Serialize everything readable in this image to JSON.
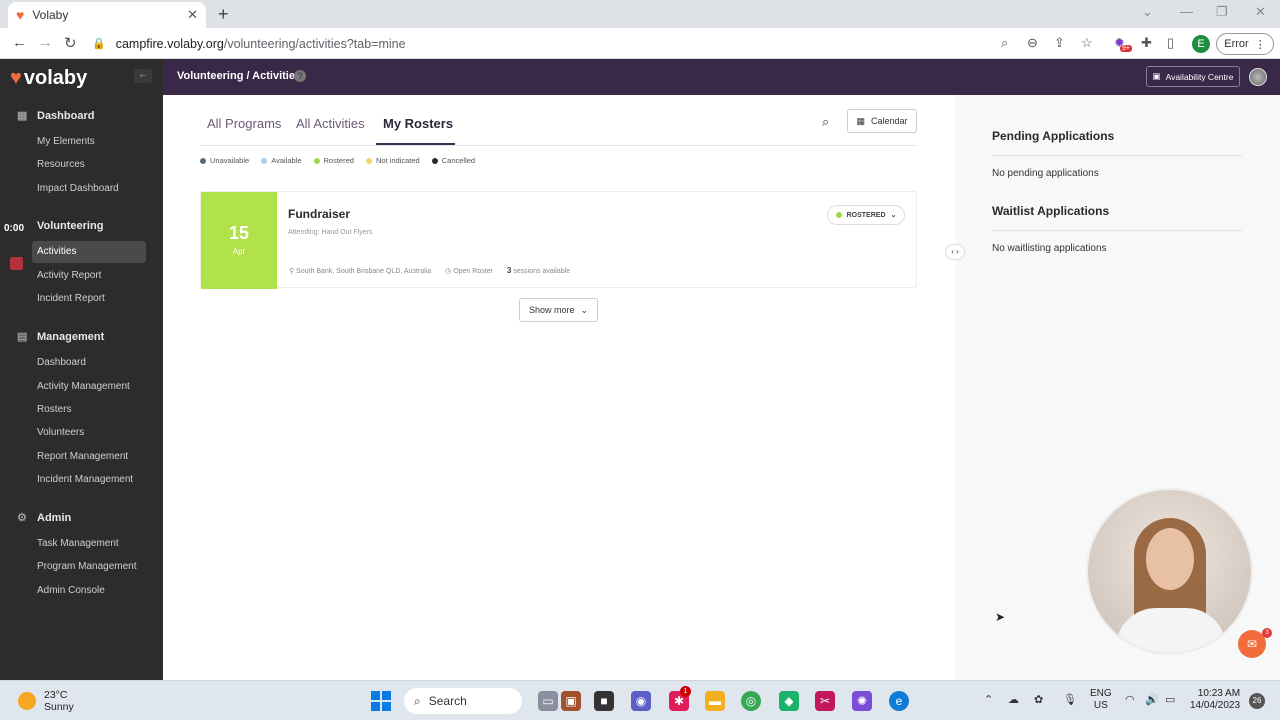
{
  "browser": {
    "tab_title": "Volaby",
    "url_host": "campfire.volaby.org",
    "url_path": "/volunteering/activities?tab=mine",
    "profile_initial": "E",
    "error_label": "Error",
    "extension_badge": "9+"
  },
  "header": {
    "breadcrumb": "Volunteering / Activities",
    "availability_label": "Availability Centre"
  },
  "sidebar": {
    "brand": "volaby",
    "timer": "0:00",
    "sections": [
      {
        "label": "Dashboard",
        "items": [
          "My Elements",
          "Resources",
          "Impact Dashboard"
        ]
      },
      {
        "label": "Volunteering",
        "items": [
          "Activities",
          "Activity Report",
          "Incident Report"
        ]
      },
      {
        "label": "Management",
        "items": [
          "Dashboard",
          "Activity Management",
          "Rosters",
          "Volunteers",
          "Report Management",
          "Incident Management"
        ]
      },
      {
        "label": "Admin",
        "items": [
          "Task Management",
          "Program Management",
          "Admin Console"
        ]
      }
    ]
  },
  "main": {
    "tabs": [
      "All Programs",
      "All Activities",
      "My Rosters"
    ],
    "active_tab": "My Rosters",
    "calendar_label": "Calendar",
    "legend": [
      {
        "label": "Unavailable",
        "color": "#5b6b78"
      },
      {
        "label": "Available",
        "color": "#a9cff0"
      },
      {
        "label": "Rostered",
        "color": "#9fd84a"
      },
      {
        "label": "Not indicated",
        "color": "#f3d46a"
      },
      {
        "label": "Cancelled",
        "color": "#2a2a3a"
      }
    ],
    "card": {
      "day": "15",
      "month": "Apr",
      "title": "Fundraiser",
      "subtitle": "Attending: Hand Out Flyers",
      "location": "South Bank, South Brisbane QLD, Australia",
      "roster_type": "Open Roster",
      "sessions_count": "3",
      "sessions_label": "sessions available",
      "status": "ROSTERED",
      "status_color": "#9fd84a",
      "date_color": "#b2e24a"
    },
    "show_more_label": "Show more"
  },
  "right_panel": {
    "pending_title": "Pending Applications",
    "pending_empty": "No pending applications",
    "waitlist_title": "Waitlist Applications",
    "waitlist_empty": "No waitlisting applications"
  },
  "chat": {
    "badge": "3"
  },
  "taskbar": {
    "temp": "23°C",
    "condition": "Sunny",
    "search_label": "Search",
    "lang_top": "ENG",
    "lang_bottom": "US",
    "time": "10:23 AM",
    "date": "14/04/2023",
    "notif_count": "26",
    "slack_badge": "1"
  }
}
